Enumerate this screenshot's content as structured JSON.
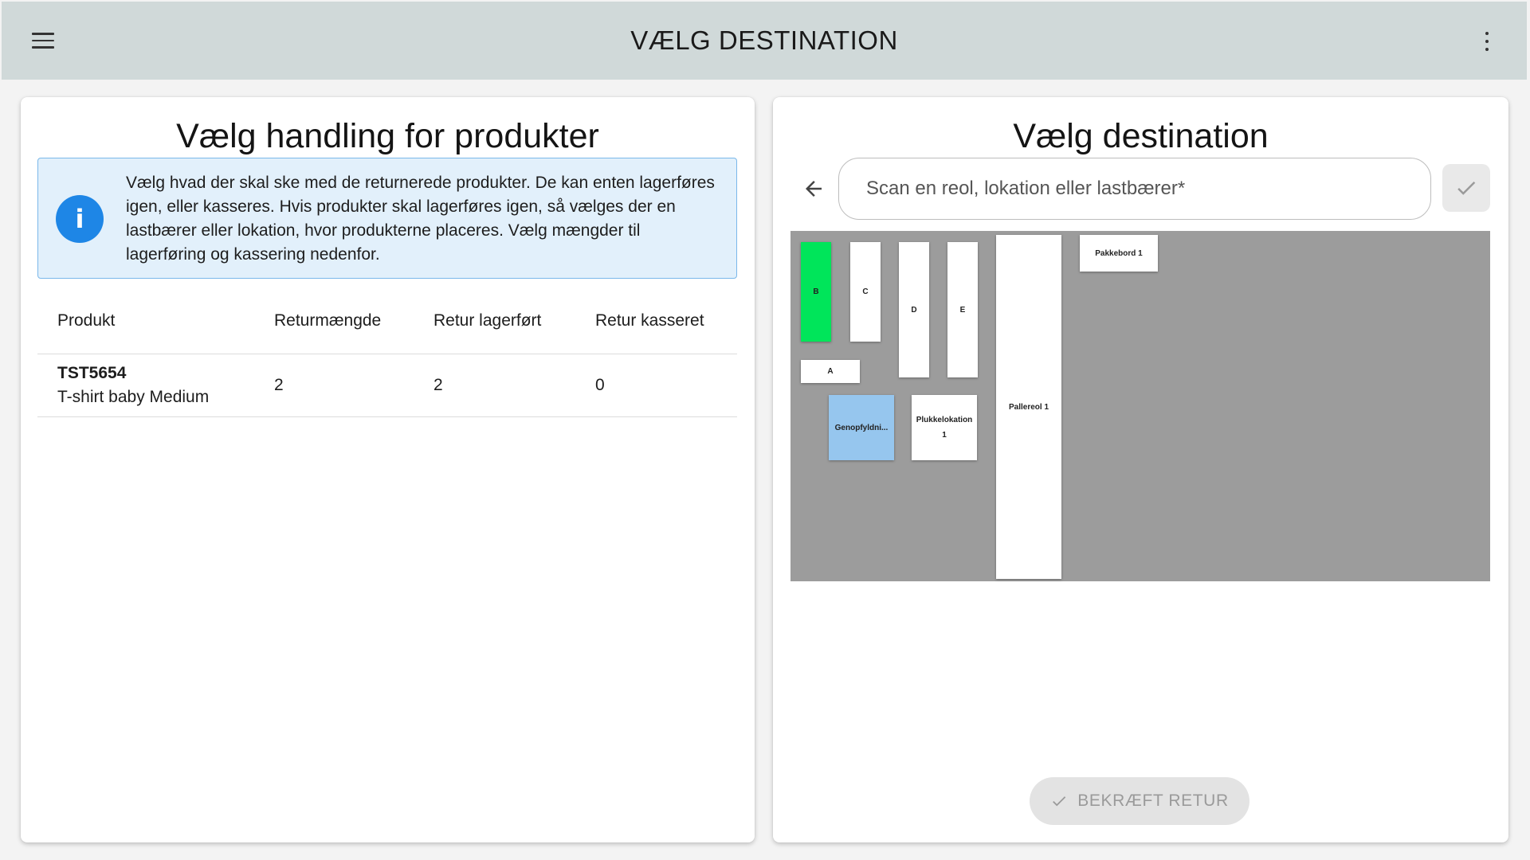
{
  "header": {
    "title": "VÆLG DESTINATION",
    "menu_icon": "hamburger-menu-icon",
    "more_icon": "more-vert-icon"
  },
  "left_panel": {
    "title": "Vælg handling for produkter",
    "info_icon": "info-icon",
    "info_text": "Vælg hvad der skal ske med de returnerede produkter. De kan enten lagerføres igen, eller kasseres. Hvis produkter skal lagerføres igen, så vælges der en lastbærer eller lokation, hvor produkterne placeres. Vælg mængder til lagerføring og kassering nedenfor.",
    "table": {
      "columns": [
        "Produkt",
        "Returmængde",
        "Retur lagerført",
        "Retur kasseret"
      ],
      "rows": [
        {
          "sku": "TST5654",
          "name": "T-shirt baby Medium",
          "returmaengde": "2",
          "retur_lagerfoert": "2",
          "retur_kasseret": "0"
        }
      ]
    }
  },
  "right_panel": {
    "title": "Vælg destination",
    "back_icon": "arrow-back-icon",
    "scan_placeholder": "Scan en reol, lokation eller lastbærer*",
    "scan_value": "",
    "confirm_icon": "check-icon",
    "map": {
      "background": "#9c9c9c",
      "locations": [
        {
          "label": "B",
          "state": "selected",
          "color": "#00e55a"
        },
        {
          "label": "C",
          "state": "normal"
        },
        {
          "label": "D",
          "state": "normal"
        },
        {
          "label": "E",
          "state": "normal"
        },
        {
          "label": "A",
          "state": "normal"
        },
        {
          "label": "Genopfyldni...",
          "state": "highlighted",
          "color": "#96c6ee"
        },
        {
          "label": "Plukkelokation 1",
          "state": "normal"
        },
        {
          "label": "Pallereol 1",
          "state": "normal"
        },
        {
          "label": "Pakkebord 1",
          "state": "normal"
        }
      ]
    },
    "confirm_button": {
      "label": "BEKRÆFT RETUR",
      "icon": "check-icon",
      "disabled": true
    }
  }
}
